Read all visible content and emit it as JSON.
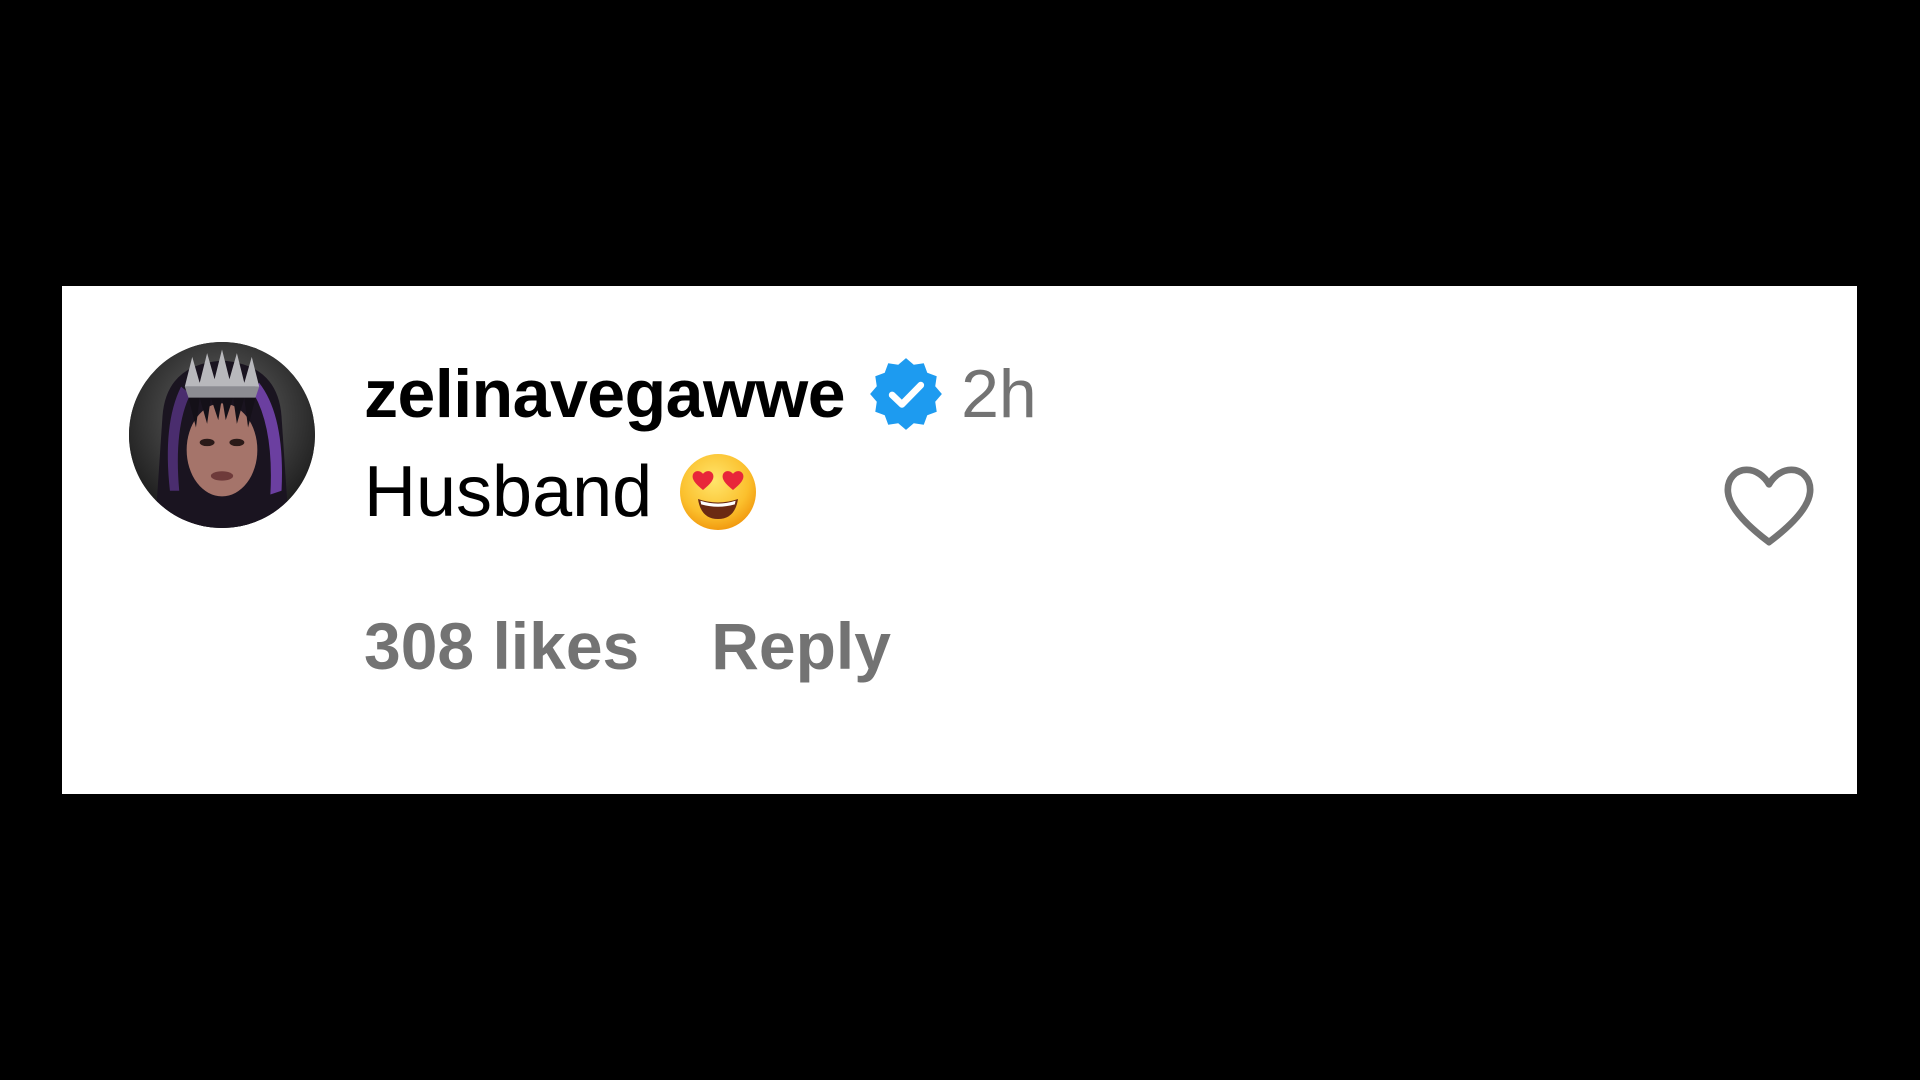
{
  "comment": {
    "username": "zelinavegawwe",
    "verified": true,
    "timestamp": "2h",
    "text": "Husband",
    "emoji": "smiling-face-with-heart-eyes",
    "likes_label": "308 likes",
    "reply_label": "Reply",
    "liked": false
  },
  "colors": {
    "background": "#000000",
    "card": "#ffffff",
    "verified_badge": "#1d9bf0",
    "muted_text": "#737373",
    "heart_outline": "#737373"
  }
}
